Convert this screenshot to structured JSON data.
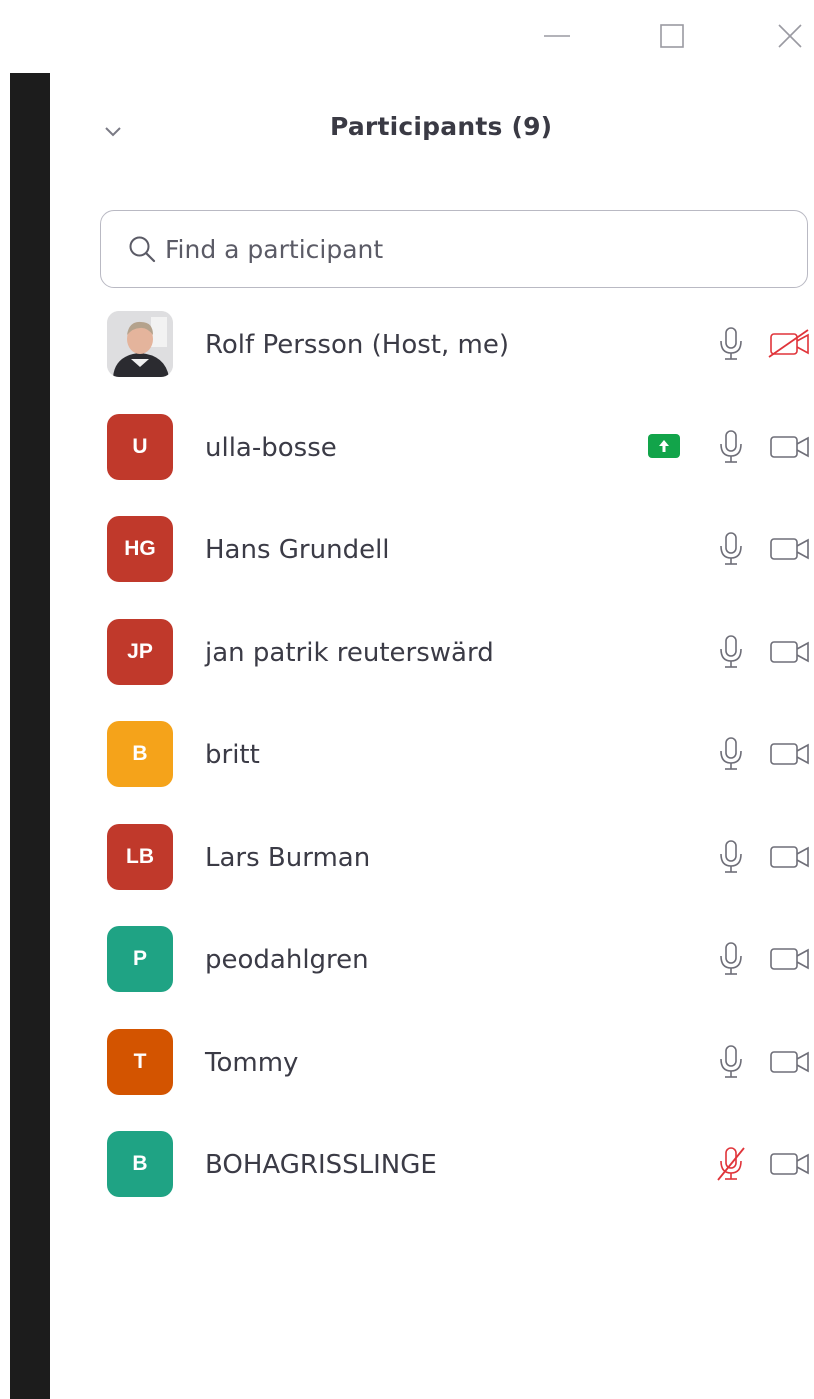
{
  "window": {
    "minimize_icon": "minimize-icon",
    "maximize_icon": "maximize-icon",
    "close_icon": "close-icon"
  },
  "header": {
    "title": "Participants (9)",
    "collapse_icon": "chevron-down-icon"
  },
  "search": {
    "placeholder": "Find a participant",
    "value": ""
  },
  "colors": {
    "red_avatar": "#c0392b",
    "orange_avatar": "#f5a31a",
    "teal_avatar": "#1fa384",
    "dark_orange_avatar": "#d35400",
    "muted_red": "#e0343a",
    "share_green": "#12a44a"
  },
  "participants": [
    {
      "name": "Rolf Persson (Host, me)",
      "initials": "",
      "avatar_type": "photo",
      "avatar_color": "",
      "mic": "on",
      "video": "off",
      "sharing": false
    },
    {
      "name": "ulla-bosse",
      "initials": "U",
      "avatar_type": "initials",
      "avatar_color": "#c0392b",
      "mic": "on",
      "video": "on",
      "sharing": true
    },
    {
      "name": "Hans Grundell",
      "initials": "HG",
      "avatar_type": "initials",
      "avatar_color": "#c0392b",
      "mic": "on",
      "video": "on",
      "sharing": false
    },
    {
      "name": "jan patrik reuterswärd",
      "initials": "JP",
      "avatar_type": "initials",
      "avatar_color": "#c0392b",
      "mic": "on",
      "video": "on",
      "sharing": false
    },
    {
      "name": "britt",
      "initials": "B",
      "avatar_type": "initials",
      "avatar_color": "#f5a31a",
      "mic": "on",
      "video": "on",
      "sharing": false
    },
    {
      "name": "Lars Burman",
      "initials": "LB",
      "avatar_type": "initials",
      "avatar_color": "#c0392b",
      "mic": "on",
      "video": "on",
      "sharing": false
    },
    {
      "name": "peodahlgren",
      "initials": "P",
      "avatar_type": "initials",
      "avatar_color": "#1fa384",
      "mic": "on",
      "video": "on",
      "sharing": false
    },
    {
      "name": "Tommy",
      "initials": "T",
      "avatar_type": "initials",
      "avatar_color": "#d35400",
      "mic": "on",
      "video": "on",
      "sharing": false
    },
    {
      "name": "BOHAGRISSLINGE",
      "initials": "B",
      "avatar_type": "initials",
      "avatar_color": "#1fa384",
      "mic": "muted",
      "video": "on",
      "sharing": false
    }
  ]
}
